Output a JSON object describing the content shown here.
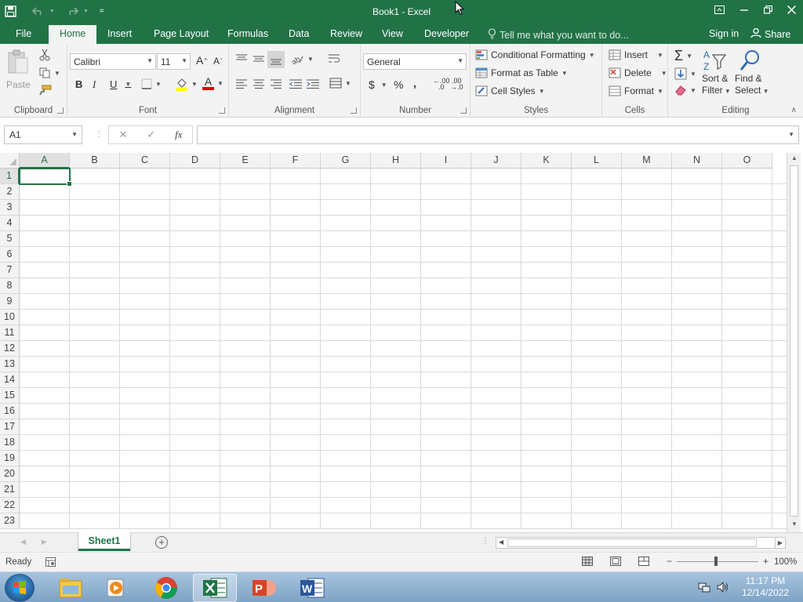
{
  "window": {
    "title": "Book1 - Excel",
    "qat_more": "="
  },
  "tabs": {
    "file": "File",
    "home": "Home",
    "insert": "Insert",
    "page_layout": "Page Layout",
    "formulas": "Formulas",
    "data": "Data",
    "review": "Review",
    "view": "View",
    "developer": "Developer",
    "tell_me": "Tell me what you want to do...",
    "sign_in": "Sign in",
    "share": "Share"
  },
  "ribbon": {
    "clipboard": {
      "paste": "Paste",
      "label": "Clipboard"
    },
    "font": {
      "name": "Calibri",
      "size": "11",
      "bold": "B",
      "italic": "I",
      "underline": "U",
      "grow": "A",
      "shrink": "A",
      "font_color": "A",
      "label": "Font"
    },
    "alignment": {
      "label": "Alignment"
    },
    "number": {
      "format": "General",
      "currency": "$",
      "percent": "%",
      "comma": ",",
      "inc_decimal": ".00",
      "dec_decimal": ".00",
      "label": "Number"
    },
    "styles": {
      "conditional": "Conditional Formatting",
      "format_table": "Format as Table",
      "cell_styles": "Cell Styles",
      "label": "Styles"
    },
    "cells": {
      "insert": "Insert",
      "delete": "Delete",
      "format": "Format",
      "label": "Cells"
    },
    "editing": {
      "sort_line1": "Sort &",
      "sort_line2": "Filter",
      "find_line1": "Find &",
      "find_line2": "Select",
      "label": "Editing"
    }
  },
  "formula_bar": {
    "name_box": "A1",
    "fx": "fx",
    "cancel": "✕",
    "enter": "✓",
    "content": ""
  },
  "grid": {
    "columns": [
      "A",
      "B",
      "C",
      "D",
      "E",
      "F",
      "G",
      "H",
      "I",
      "J",
      "K",
      "L",
      "M",
      "N",
      "O"
    ],
    "rows": [
      "1",
      "2",
      "3",
      "4",
      "5",
      "6",
      "7",
      "8",
      "9",
      "10",
      "11",
      "12",
      "13",
      "14",
      "15",
      "16",
      "17",
      "18",
      "19",
      "20",
      "21",
      "22",
      "23"
    ],
    "selected_column": "A",
    "selected_row": "1"
  },
  "sheets": {
    "tabs": [
      "Sheet1"
    ],
    "active": "Sheet1",
    "add": "+"
  },
  "status": {
    "mode": "Ready",
    "zoom": "100%",
    "zoom_minus": "−",
    "zoom_plus": "+"
  },
  "taskbar": {
    "time": "11:17 PM",
    "date": "12/14/2022"
  },
  "colors": {
    "accent": "#217346",
    "ribbon_bg": "#f3f3f3"
  }
}
